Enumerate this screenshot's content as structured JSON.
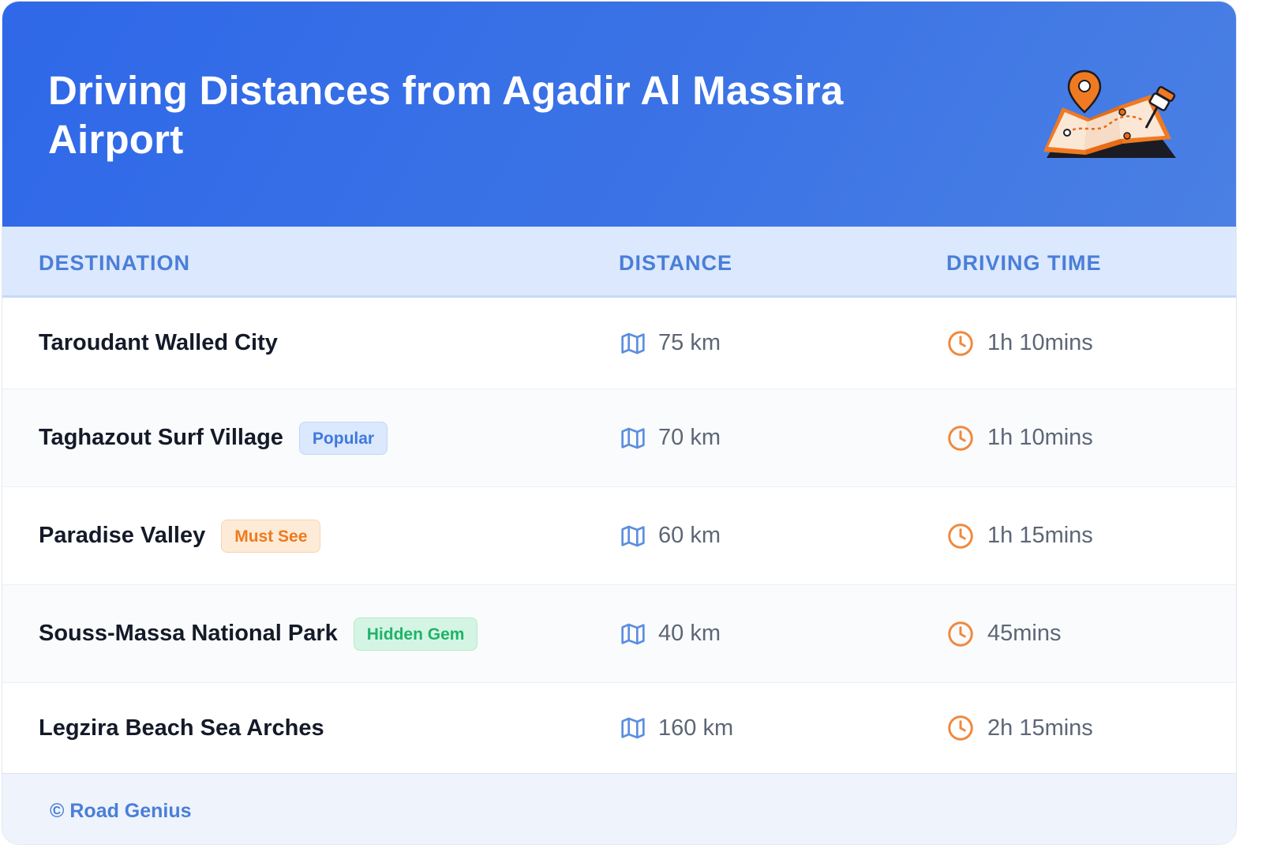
{
  "header": {
    "title": "Driving Distances from Agadir Al Massira Airport",
    "illustration_icon": "map-with-pins-icon"
  },
  "table": {
    "columns": [
      "DESTINATION",
      "DISTANCE",
      "DRIVING TIME"
    ],
    "rows": [
      {
        "destination": "Taroudant Walled City",
        "badge": "",
        "distance": "75 km",
        "time": "1h 10mins"
      },
      {
        "destination": "Taghazout Surf Village",
        "badge": "Popular",
        "distance": "70 km",
        "time": "1h 10mins"
      },
      {
        "destination": "Paradise Valley",
        "badge": "Must See",
        "distance": "60 km",
        "time": "1h 15mins"
      },
      {
        "destination": "Souss-Massa National Park",
        "badge": "Hidden Gem",
        "distance": "40 km",
        "time": "45mins"
      },
      {
        "destination": "Legzira Beach Sea Arches",
        "badge": "",
        "distance": "160 km",
        "time": "2h 15mins"
      }
    ],
    "distance_icon": "map-icon",
    "time_icon": "clock-icon"
  },
  "footer": {
    "credit": "© Road Genius"
  },
  "colors": {
    "header_gradient_start": "#2f68e8",
    "header_gradient_end": "#4a80e3",
    "accent_blue": "#4a7ed8",
    "badge_popular": "#3f78de",
    "badge_must_see": "#ee7a1e",
    "badge_hidden_gem": "#1fb368",
    "clock_orange": "#f0893e"
  }
}
